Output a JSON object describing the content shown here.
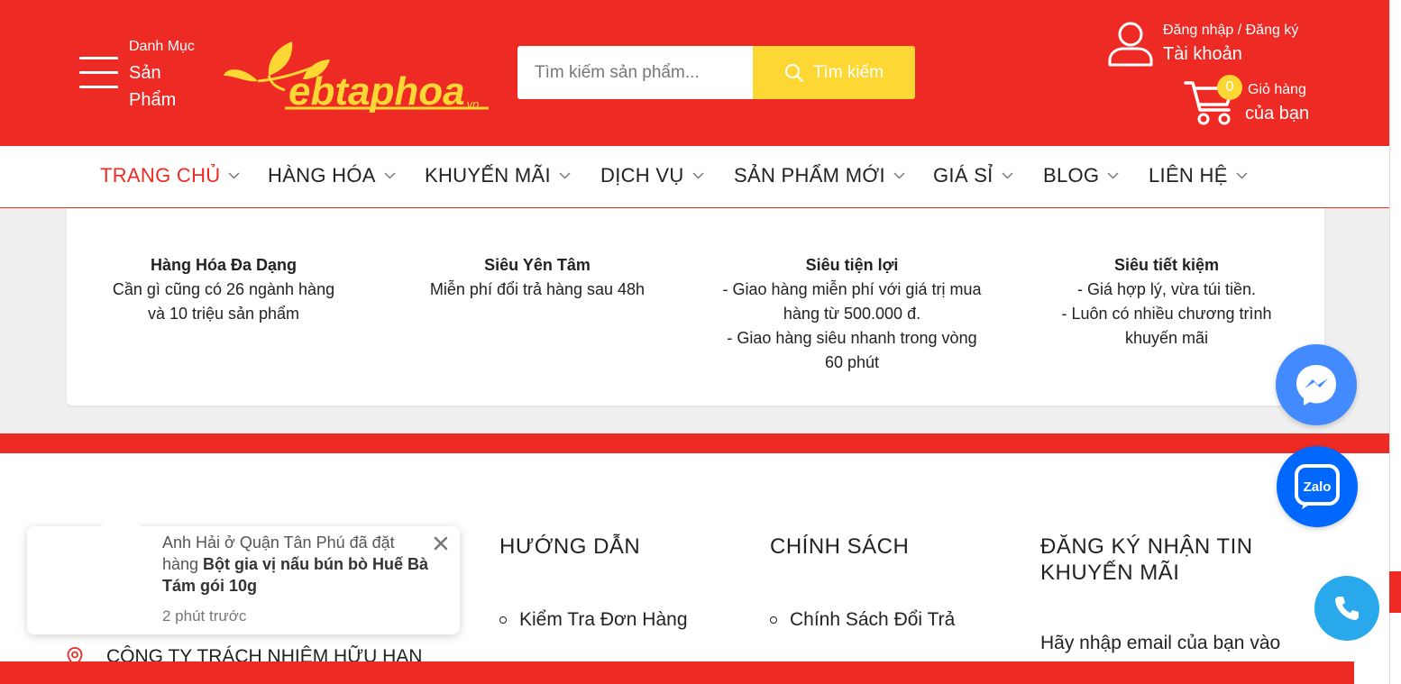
{
  "header": {
    "menu_small": "Danh Mục",
    "menu_big": "Sản Phẩm",
    "logo_text": "ebtaphoa",
    "logo_sub": ".vn",
    "search_placeholder": "Tìm kiếm sản phẩm...",
    "search_button": "Tìm kiếm",
    "account_small": "Đăng nhập / Đăng ký",
    "account_big": "Tài khoản",
    "cart_count": "0",
    "cart_small": "Giỏ hàng",
    "cart_big": "của bạn"
  },
  "nav": {
    "items": [
      {
        "label": "TRANG CHỦ"
      },
      {
        "label": "HÀNG HÓA"
      },
      {
        "label": "KHUYẾN MÃI"
      },
      {
        "label": "DỊCH VỤ"
      },
      {
        "label": "SẢN PHẨM MỚI"
      },
      {
        "label": "GIÁ SỈ"
      },
      {
        "label": "BLOG"
      },
      {
        "label": "LIÊN HỆ"
      }
    ]
  },
  "features": [
    {
      "title": "Hàng Hóa Đa Dạng",
      "lines": [
        "Cần gì cũng có 26 ngành hàng",
        "và 10 triệu sản phẩm"
      ]
    },
    {
      "title": "Siêu Yên Tâm",
      "lines": [
        "Miễn phí đổi trả hàng sau 48h"
      ]
    },
    {
      "title": "Siêu tiện lợi",
      "lines": [
        "- Giao hàng miễn phí với giá trị mua",
        "hàng từ 500.000 đ.",
        "- Giao hàng siêu nhanh trong vòng",
        "60 phút"
      ]
    },
    {
      "title": "Siêu tiết kiệm",
      "lines": [
        "- Giá hợp lý, vừa túi tiền.",
        "- Luôn có nhiều chương trình",
        "khuyến mãi"
      ]
    }
  ],
  "footer": {
    "guide_title": "HƯỚNG DẪN",
    "guide_link": "Kiểm Tra Đơn Hàng",
    "policy_title": "CHÍNH SÁCH",
    "policy_link": "Chính Sách Đổi Trả",
    "subscribe_title_1": "ĐĂNG KÝ NHẬN TIN",
    "subscribe_title_2": "KHUYẾN MÃI",
    "subscribe_text": "Hãy nhập email của bạn vào",
    "company": "CÔNG TY TRÁCH NHIỆM HỮU HẠN"
  },
  "toast": {
    "prefix": "Anh Hải ở Quận Tân Phú đã đặt hàng ",
    "product": "Bột gia vị nấu bún bò Huế Bà Tám gói 10g",
    "time": "2 phút trước"
  },
  "floating": {
    "zalo_label": "Zalo"
  },
  "colors": {
    "brand_red": "#ee2a24",
    "accent_yellow": "#fdd835",
    "messenger_blue": "#448aff",
    "zalo_blue": "#0068ff",
    "phone_blue": "#29a9eb"
  }
}
